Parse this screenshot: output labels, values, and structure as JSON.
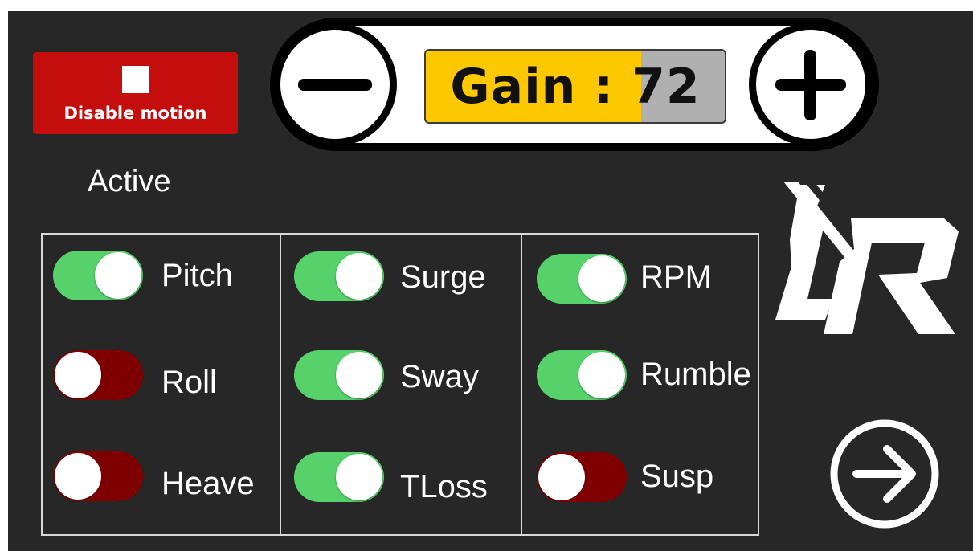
{
  "header": {
    "disable_button_label": "Disable motion",
    "gain": {
      "label": "Gain : 72",
      "value": 72,
      "fill_fraction": 0.72
    },
    "decrease_icon": "minus-icon",
    "increase_icon": "plus-icon"
  },
  "active_label": "Active",
  "toggles": [
    {
      "label": "Pitch",
      "on": true
    },
    {
      "label": "Roll",
      "on": false
    },
    {
      "label": "Heave",
      "on": false
    },
    {
      "label": "Surge",
      "on": true
    },
    {
      "label": "Sway",
      "on": true
    },
    {
      "label": "TLoss",
      "on": true
    },
    {
      "label": "RPM",
      "on": true
    },
    {
      "label": "Rumble",
      "on": true
    },
    {
      "label": "Susp",
      "on": false
    }
  ],
  "logo_text": "LR",
  "next_icon": "arrow-right-circle-icon",
  "colors": {
    "background": "#272727",
    "disable_button": "#c40d0d",
    "toggle_on": "#57d26b",
    "toggle_off": "#7f0000",
    "gain_fill": "#fec800",
    "gain_empty": "#b0b0b0"
  }
}
